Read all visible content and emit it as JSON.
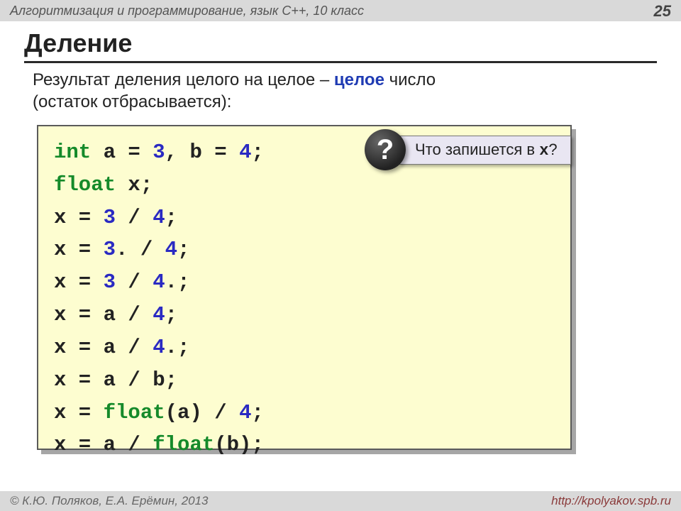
{
  "header": {
    "course": "Алгоритмизация и программирование, язык  C++, 10 класс",
    "page": "25"
  },
  "title": "Деление",
  "description": {
    "line1_a": "Результат деления целого на целое – ",
    "line1_em": "целое",
    "line1_b": " число",
    "line2": "(остаток отбрасывается):"
  },
  "code": {
    "kw_int": "int",
    "decl_rest": " a = ",
    "n3a": "3",
    "comma_b": ", b = ",
    "n4a": "4",
    "semi": ";",
    "kw_float": "float",
    "decl_x": " x;",
    "l3_a": "x = ",
    "l3_n1": "3",
    "l3_mid": " / ",
    "l3_n2": "4",
    "l3_end": ";",
    "l4_a": "x = ",
    "l4_n1": "3",
    "l4_dot": ".",
    "l4_mid": " / ",
    "l4_n2": "4",
    "l4_end": ";",
    "l5_a": "x = ",
    "l5_n1": "3",
    "l5_mid": " / ",
    "l5_n2": "4",
    "l5_dot": ".",
    "l5_end": ";",
    "l6_a": "x = a / ",
    "l6_n": "4",
    "l6_end": ";",
    "l7_a": "x = a / ",
    "l7_n": "4",
    "l7_dot": ".",
    "l7_end": ";",
    "l8": "x = a / b;",
    "l9_a": "x = ",
    "l9_fn": "float",
    "l9_b": "(a) / ",
    "l9_n": "4",
    "l9_end": ";",
    "l10_a": "x = a / ",
    "l10_fn": "float",
    "l10_b": "(b);"
  },
  "callout": {
    "icon": "?",
    "text_a": " Что запишется в ",
    "var": "x",
    "text_b": "?"
  },
  "footer": {
    "copyright": "© К.Ю. Поляков, Е.А. Ерёмин, 2013",
    "url": "http://kpolyakov.spb.ru"
  }
}
